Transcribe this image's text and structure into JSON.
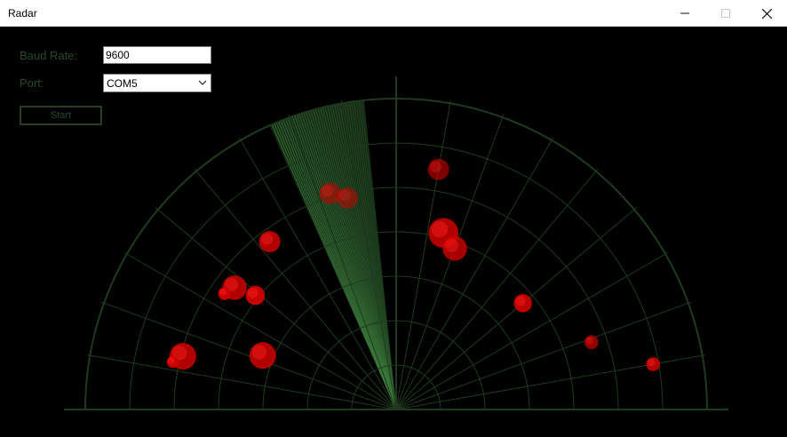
{
  "window": {
    "title": "Radar"
  },
  "controls": {
    "baud_label": "Baud Rate:",
    "baud_value": "9600",
    "port_label": "Port:",
    "port_value": "COM5",
    "start_label": "Start"
  },
  "colors": {
    "background": "#000000",
    "grid": "#1f3a1f",
    "sweep": "#3b7a3b",
    "target": "#d00000",
    "label": "#2c4a2c"
  },
  "radar": {
    "range_rings": 7,
    "angle_step_deg": 10,
    "sweep_center_deg": 108
  },
  "targets": [
    {
      "angle_deg": 107,
      "range": 0.727,
      "size": 1.0,
      "opacity": 0.55
    },
    {
      "angle_deg": 103,
      "range": 0.698,
      "size": 1.0,
      "opacity": 0.5
    },
    {
      "angle_deg": 80,
      "range": 0.784,
      "size": 1.0,
      "opacity": 0.6
    },
    {
      "angle_deg": 75,
      "range": 0.588,
      "size": 1.4,
      "opacity": 0.85
    },
    {
      "angle_deg": 70,
      "range": 0.551,
      "size": 1.15,
      "opacity": 0.8
    },
    {
      "angle_deg": 127,
      "range": 0.676,
      "size": 1.0,
      "opacity": 0.85
    },
    {
      "angle_deg": 141,
      "range": 0.583,
      "size": 0.9,
      "opacity": 0.95
    },
    {
      "angle_deg": 143,
      "range": 0.651,
      "size": 1.15,
      "opacity": 0.85
    },
    {
      "angle_deg": 146,
      "range": 0.666,
      "size": 0.6,
      "opacity": 0.95
    },
    {
      "angle_deg": 166,
      "range": 0.707,
      "size": 1.25,
      "opacity": 0.85
    },
    {
      "angle_deg": 168,
      "range": 0.735,
      "size": 0.55,
      "opacity": 0.95
    },
    {
      "angle_deg": 158,
      "range": 0.463,
      "size": 1.25,
      "opacity": 0.85
    },
    {
      "angle_deg": 40,
      "range": 0.532,
      "size": 0.85,
      "opacity": 0.9
    },
    {
      "angle_deg": 19,
      "range": 0.664,
      "size": 0.65,
      "opacity": 0.7
    },
    {
      "angle_deg": 10,
      "range": 0.839,
      "size": 0.65,
      "opacity": 0.85
    }
  ]
}
